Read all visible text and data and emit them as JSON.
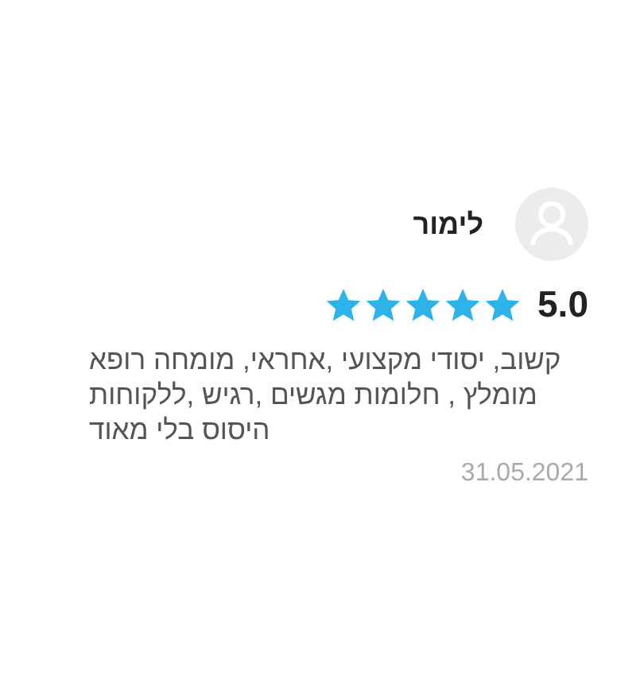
{
  "review": {
    "author": "לימור",
    "rating": "5.0",
    "stars": 5,
    "text": "רופא מומחה ,אחראי, מקצועי יסודי ,קשוב ללקוחות, רגיש, מגשים חלומות , מומלץ מאוד בלי היסוס",
    "date": "31.05.2021"
  }
}
